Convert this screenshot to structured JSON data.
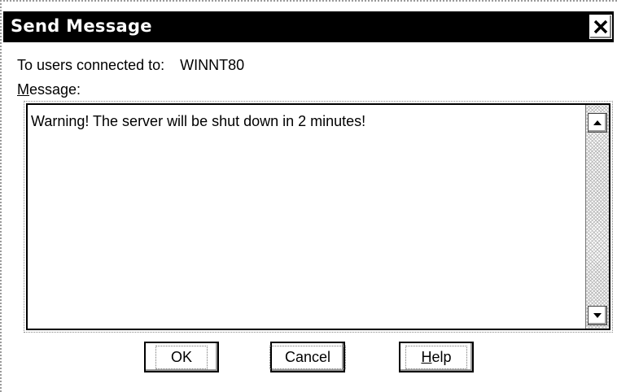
{
  "window": {
    "title": "Send Message",
    "close_icon": "close-icon"
  },
  "form": {
    "to_label": "To users connected to:",
    "server_name": "WINNT80",
    "message_label_mnemonic": "M",
    "message_label_rest": "essage:",
    "message_text": "Warning! The server will be shut down in 2 minutes!"
  },
  "buttons": {
    "ok": "OK",
    "cancel": "Cancel",
    "help_mnemonic": "H",
    "help_rest": "elp"
  },
  "icons": {
    "scroll_up": "scroll-up-arrow-icon",
    "scroll_down": "scroll-down-arrow-icon"
  }
}
